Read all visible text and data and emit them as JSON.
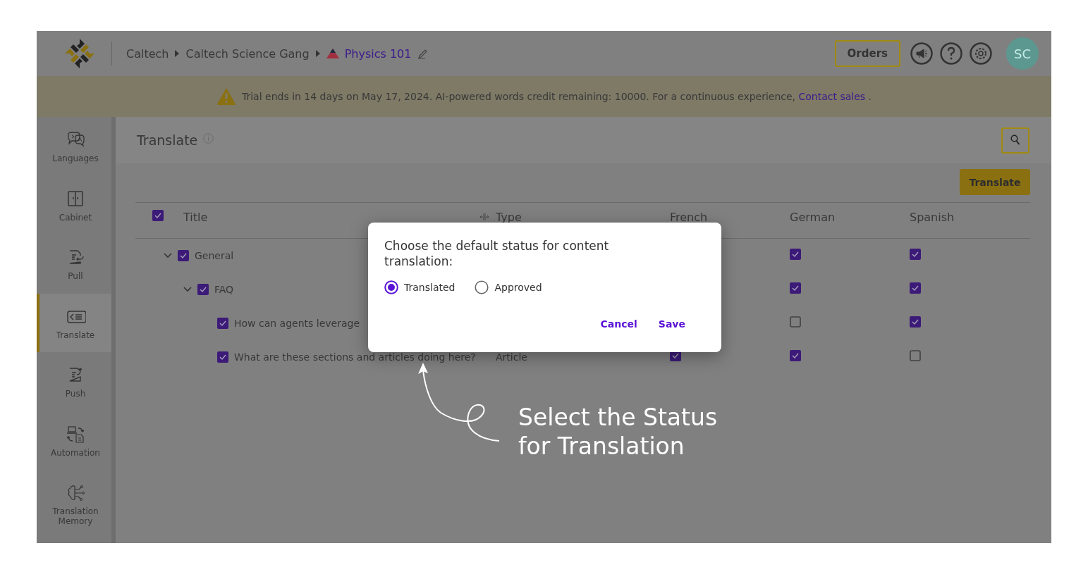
{
  "header": {
    "breadcrumbs": [
      {
        "label": "Caltech",
        "current": false
      },
      {
        "label": "Caltech Science Gang",
        "current": false
      },
      {
        "label": "Physics 101",
        "current": true
      }
    ],
    "orders_button": "Orders",
    "avatar": "SC"
  },
  "banner": {
    "message": "Trial ends in 14 days on May 17, 2024. AI-powered words credit remaining: 10000. For a continuous experience,",
    "link": "Contact sales",
    "trailing": "."
  },
  "sidebar": {
    "items": [
      {
        "label": "Languages",
        "selected": false
      },
      {
        "label": "Cabinet",
        "selected": false
      },
      {
        "label": "Pull",
        "selected": false
      },
      {
        "label": "Translate",
        "selected": true
      },
      {
        "label": "Push",
        "selected": false
      },
      {
        "label": "Automation",
        "selected": false
      },
      {
        "label": "Translation Memory",
        "selected": false
      }
    ]
  },
  "page": {
    "title": "Translate",
    "translate_button": "Translate"
  },
  "table": {
    "all_checked": true,
    "columns": [
      "Title",
      "Type",
      "French",
      "German",
      "Spanish"
    ],
    "rows": [
      {
        "title": "General",
        "checked": true,
        "expanded": true,
        "german": true,
        "spanish": true,
        "children": [
          {
            "title": "FAQ",
            "checked": true,
            "expanded": true,
            "german": true,
            "spanish": true,
            "children": [
              {
                "title": "How can agents leverage",
                "checked": true,
                "german": false,
                "spanish": true
              },
              {
                "title": "What are these sections and articles doing here?",
                "checked": true,
                "type": "Article",
                "french": true,
                "german": true,
                "spanish": false
              }
            ]
          }
        ]
      }
    ]
  },
  "dialog": {
    "title": "Choose the default status for content translation:",
    "options": [
      {
        "label": "Translated",
        "selected": true
      },
      {
        "label": "Approved",
        "selected": false
      }
    ],
    "buttons": [
      "Cancel",
      "Save"
    ]
  },
  "annotation": {
    "text": "Select the Status\nfor Translation"
  }
}
